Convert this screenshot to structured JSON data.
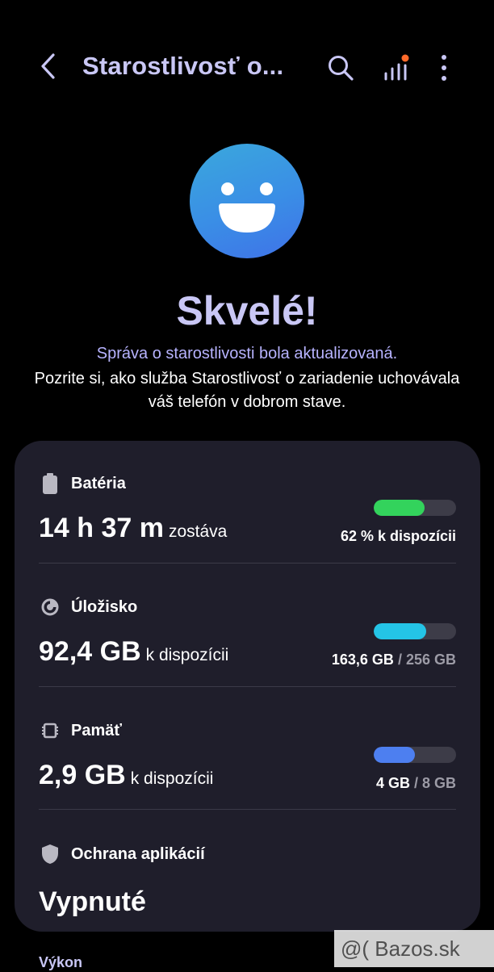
{
  "header": {
    "title": "Starostlivosť o...",
    "back_icon": "chevron-left-icon",
    "search_icon": "search-icon",
    "signal_icon": "signal-bars-icon",
    "more_icon": "more-vertical-icon",
    "notification_dot_color": "#ff6a2a"
  },
  "status": {
    "headline": "Skvelé!",
    "line1": "Správa o starostlivosti bola aktualizovaná.",
    "line2": "Pozrite si, ako služba Starostlivosť o zariadenie uchovávala váš telefón v dobrom stave."
  },
  "battery": {
    "label": "Batéria",
    "value": "14 h 37 m",
    "unit": "zostáva",
    "detail": "62 % k dispozícii",
    "fill_percent": 62,
    "color": "#33d35c"
  },
  "storage": {
    "label": "Úložisko",
    "value": "92,4 GB",
    "unit": "k dispozícii",
    "used": "163,6 GB",
    "total": "/ 256 GB",
    "fill_percent": 64,
    "color": "#24c4e6"
  },
  "memory": {
    "label": "Pamäť",
    "value": "2,9 GB",
    "unit": "k dispozícii",
    "used": "4 GB",
    "total": "/ 8 GB",
    "fill_percent": 50,
    "color": "#4d7ff0"
  },
  "protection": {
    "label": "Ochrana aplikácií",
    "value": "Vypnuté"
  },
  "next_section": {
    "label": "Výkon"
  },
  "watermark": {
    "text": "@( Bazos.sk"
  }
}
